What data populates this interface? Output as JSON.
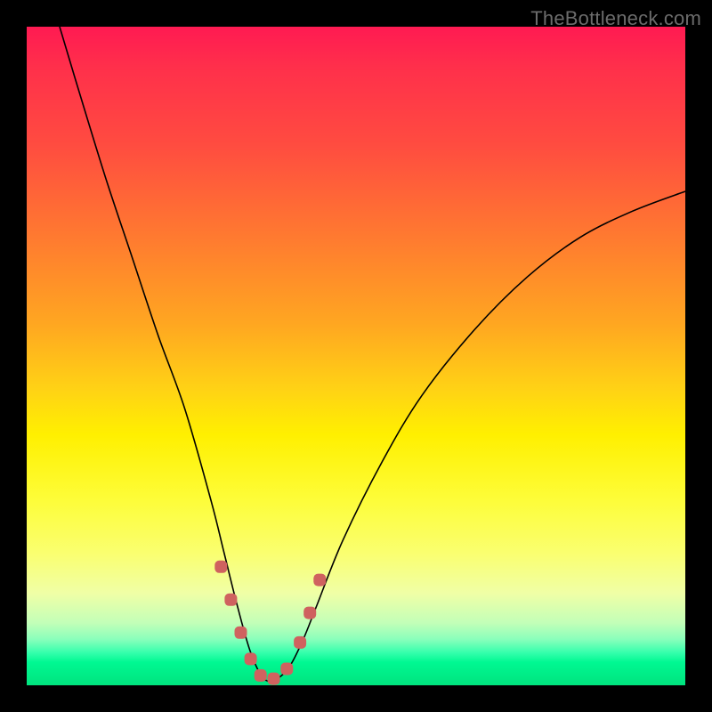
{
  "watermark": "TheBottleneck.com",
  "colors": {
    "frame_bg": "#000000",
    "curve_stroke": "#000000",
    "marker_fill": "#cf625f",
    "gradient_stops": [
      "#ff1a52",
      "#ff2f4b",
      "#ff4c40",
      "#ff7a30",
      "#ffa621",
      "#ffd215",
      "#fff000",
      "#fdfd3a",
      "#faff70",
      "#f0ffa6",
      "#c3ffb8",
      "#8affbb",
      "#37ffad",
      "#00f892",
      "#00e37e"
    ]
  },
  "chart_data": {
    "type": "line",
    "title": "",
    "xlabel": "",
    "ylabel": "",
    "xlim": [
      0,
      100
    ],
    "ylim": [
      0,
      100
    ],
    "note": "Gradient background encodes value from red=100 (top) to green=0 (bottom). Curve shows bottleneck-style V shape with minimum near x≈36.",
    "series": [
      {
        "name": "curve",
        "x": [
          5,
          8,
          12,
          16,
          20,
          24,
          28,
          30,
          32,
          34,
          36,
          38,
          40,
          42,
          44,
          48,
          54,
          60,
          68,
          76,
          84,
          92,
          100
        ],
        "y": [
          100,
          90,
          77,
          65,
          53,
          42,
          28,
          20,
          12,
          5,
          1,
          1,
          3,
          7,
          12,
          22,
          34,
          44,
          54,
          62,
          68,
          72,
          75
        ]
      }
    ],
    "markers": {
      "name": "highlight-points",
      "x": [
        29.5,
        31.0,
        32.5,
        34.0,
        35.5,
        37.5,
        39.5,
        41.5,
        43.0,
        44.5
      ],
      "y": [
        18,
        13,
        8,
        4,
        1.5,
        1,
        2.5,
        6.5,
        11,
        16
      ]
    }
  }
}
